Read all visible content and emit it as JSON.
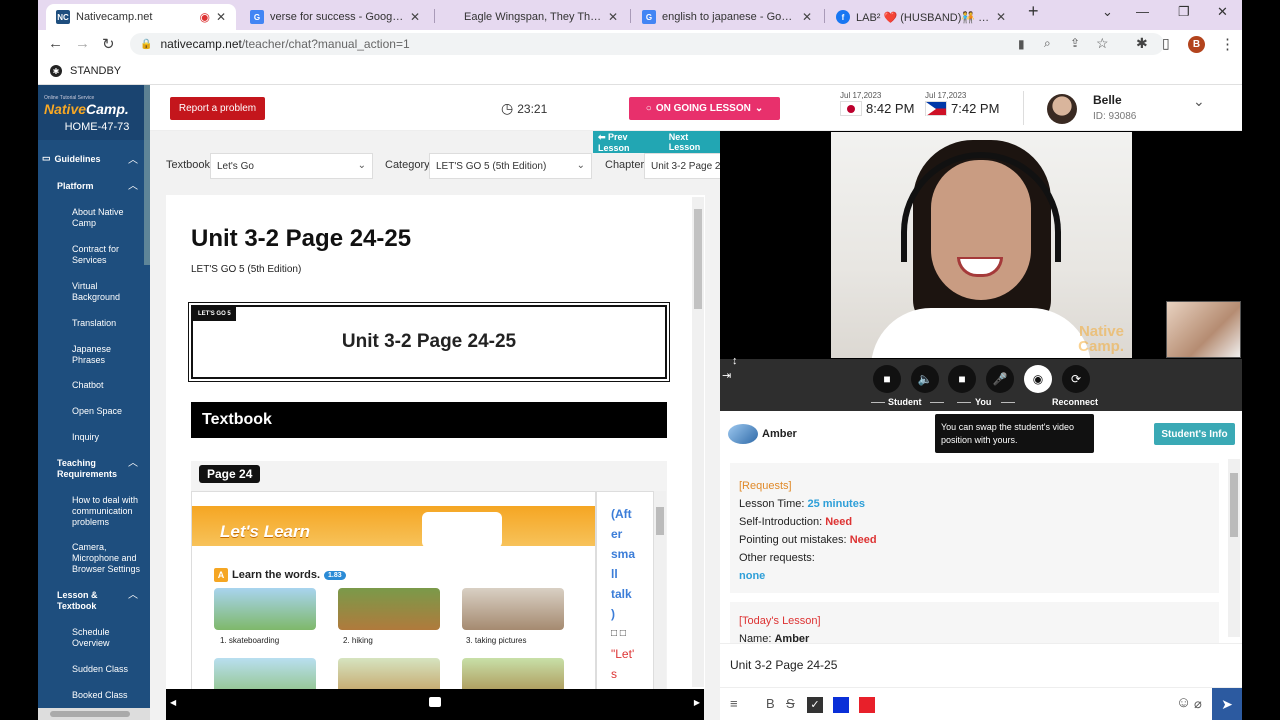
{
  "browser": {
    "tabs": [
      {
        "title": "Nativecamp.net",
        "favicon": "NC",
        "favicon_color": "#1e4e7e",
        "active": true,
        "recording": true
      },
      {
        "title": "verse for success - Google Search",
        "favicon": "G",
        "favicon_color": "#4285f4",
        "active": false
      },
      {
        "title": "Eagle Wingspan, They That Wait",
        "favicon": "",
        "favicon_color": "#e6d9f0",
        "active": false
      },
      {
        "title": "english to japanese - Google Sea",
        "favicon": "G",
        "favicon_color": "#4285f4",
        "active": false
      },
      {
        "title": "LAB² ❤️ (HUSBAND)🧑‍🤝‍🧑 message",
        "favicon": "f",
        "favicon_color": "#1877f2",
        "active": false
      }
    ],
    "url_host": "nativecamp.net",
    "url_path": "/teacher/chat?manual_action=1",
    "profile_initial": "B",
    "bookmark_label": "STANDBY"
  },
  "sidebar": {
    "logo_small": "Online Tutorial Service",
    "logo_native": "Native",
    "logo_camp": "Camp.",
    "home_code": "HOME-47-73",
    "guidelines": "Guidelines",
    "platform": "Platform",
    "platform_items": [
      "About Native Camp",
      "Contract for Services",
      "Virtual Background",
      "Translation",
      "Japanese Phrases",
      "Chatbot",
      "Open Space",
      "Inquiry"
    ],
    "teaching": "Teaching Requirements",
    "teaching_items": [
      "How to deal with communication problems",
      "Camera, Microphone and Browser Settings"
    ],
    "lesson": "Lesson & Textbook",
    "lesson_items": [
      "Schedule Overview",
      "Sudden Class",
      "Booked Class"
    ]
  },
  "header": {
    "report_label": "Report a problem",
    "timer": "23:21",
    "ongoing_label": "ON GOING LESSON",
    "jp_date": "Jul 17,2023",
    "jp_time": "8:42 PM",
    "ph_date": "Jul 17,2023",
    "ph_time": "7:42 PM",
    "tutor_name": "Belle",
    "tutor_id": "ID: 93086"
  },
  "textbook": {
    "prev_label": "Prev Lesson",
    "next_label": "Next Lesson",
    "textbook_label": "Textbook",
    "textbook_value": "Let's Go",
    "category_label": "Category",
    "category_value": "LET'S GO 5 (5th Edition)",
    "chapter_label": "Chapter",
    "chapter_value": "Unit 3-2 Page 2",
    "title": "Unit 3-2 Page 24-25",
    "subtitle": "LET'S GO 5 (5th Edition)",
    "unit_tag": "LET'S GO 5",
    "unit_box_title": "Unit 3-2 Page 24-25",
    "section": "Textbook",
    "page_tag": "Page 24",
    "lets_learn": "Let's Learn",
    "learn_words": "Learn the words.",
    "audio_tag": "1.83",
    "words": [
      "1. skateboarding",
      "2. hiking",
      "3. taking pictures"
    ],
    "side_note": "(After small talk)",
    "side_note_lines": [
      "(Aft",
      "er",
      "sma",
      "ll",
      "talk",
      ")"
    ],
    "side_quote": "\"Let'",
    "side_quote2": "s",
    "side_boxes": "□ □"
  },
  "video": {
    "watermark1": "Native",
    "watermark2": "Camp.",
    "student_label": "Student",
    "you_label": "You",
    "reconnect_label": "Reconnect"
  },
  "chat": {
    "student_name": "Amber",
    "tooltip": "You can swap the student's video position with yours.",
    "student_info_btn": "Student's Info",
    "requests_title": "[Requests]",
    "lesson_time_label": "Lesson Time:",
    "lesson_time_value": "25 minutes",
    "self_intro_label": "Self-Introduction:",
    "self_intro_value": "Need",
    "pointing_label": "Pointing out mistakes:",
    "pointing_value": "Need",
    "other_label": "Other requests:",
    "other_value": "none",
    "today_title": "[Today's Lesson]",
    "name_label": "Name:",
    "name_value": "Amber",
    "compose_text": "Unit 3-2 Page 24-25"
  }
}
